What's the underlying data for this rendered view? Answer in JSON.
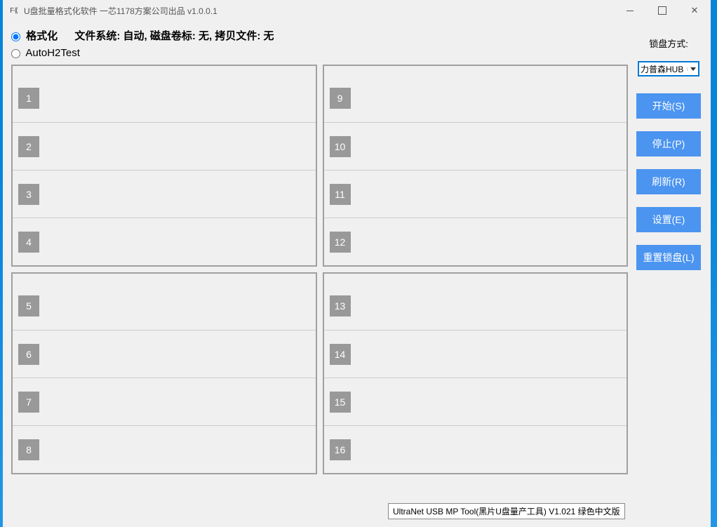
{
  "window": {
    "title": "U盘批量格式化软件  一芯1178方案公司出品 v1.0.0.1"
  },
  "options": {
    "format_label": "格式化",
    "config_text": "文件系统: 自动, 磁盘卷标: 无, 拷贝文件: 无",
    "autoh2_label": "AutoH2Test"
  },
  "slots": {
    "panel1": [
      "1",
      "2",
      "3",
      "4"
    ],
    "panel2": [
      "9",
      "10",
      "11",
      "12"
    ],
    "panel3": [
      "5",
      "6",
      "7",
      "8"
    ],
    "panel4": [
      "13",
      "14",
      "15",
      "16"
    ]
  },
  "sidebar": {
    "lock_label": "锁盘方式:",
    "select_value": "力普森HUB",
    "buttons": {
      "start": "开始(S)",
      "stop": "停止(P)",
      "refresh": "刷新(R)",
      "settings": "设置(E)",
      "reset": "重置锁盘(L)"
    }
  },
  "tooltip": "UltraNet USB MP Tool(黑片U盘量产工具) V1.021 绿色中文版"
}
